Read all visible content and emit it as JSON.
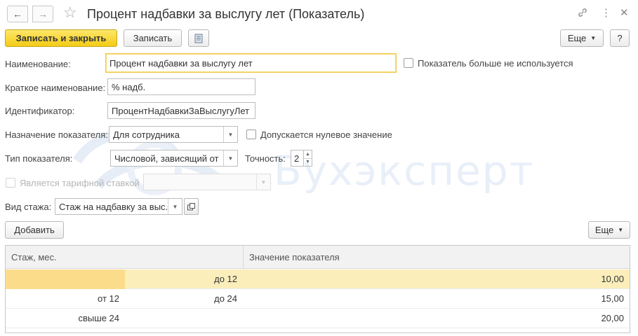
{
  "window": {
    "title": "Процент надбавки за выслугу лет (Показатель)",
    "back_icon": "arrow-left-icon",
    "forward_icon": "arrow-right-icon",
    "favorite_icon": "star-icon",
    "link_icon": "link-icon",
    "more_icon": "more-vertical-icon",
    "close_icon": "close-icon"
  },
  "toolbar": {
    "save_close_label": "Записать и закрыть",
    "save_label": "Записать",
    "more_label": "Еще",
    "help_label": "?"
  },
  "form": {
    "name_label": "Наименование:",
    "name_value": "Процент надбавки за выслугу лет",
    "not_used_label": "Показатель больше не используется",
    "short_name_label": "Краткое наименование:",
    "short_name_value": "% надб.",
    "id_label": "Идентификатор:",
    "id_value": "ПроцентНадбавкиЗаВыслугуЛет",
    "purpose_label": "Назначение показателя:",
    "purpose_value": "Для сотрудника",
    "zero_allowed_label": "Допускается нулевое значение",
    "type_label": "Тип показателя:",
    "type_value": "Числовой, зависящий от",
    "precision_label": "Точность:",
    "precision_value": "2",
    "tariff_label": "Является тарифной ставкой",
    "stazh_label": "Вид стажа:",
    "stazh_value": "Стаж на надбавку за выс."
  },
  "table_toolbar": {
    "add_label": "Добавить",
    "more_label": "Еще"
  },
  "table": {
    "columns": [
      "Стаж, мес.",
      "Значение показателя"
    ],
    "rows": [
      {
        "from": "",
        "to": "до 12",
        "value": "10,00"
      },
      {
        "from": "от 12",
        "to": "до 24",
        "value": "15,00"
      },
      {
        "from": "свыше 24",
        "to": "",
        "value": "20,00"
      }
    ]
  },
  "watermark_text": "Бухэксперт",
  "colors": {
    "primary_button": "#f3cc16",
    "selected_row": "#fbeebb",
    "selected_cell": "#fbdc8b",
    "focus_border": "#f2c94c"
  }
}
